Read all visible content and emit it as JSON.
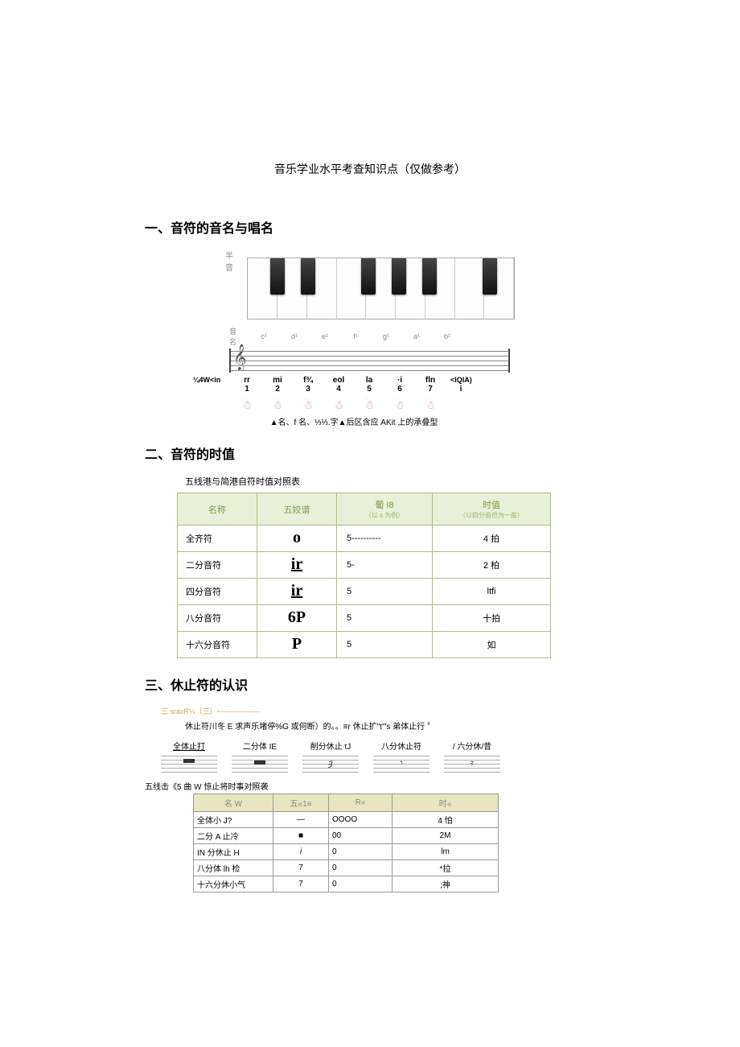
{
  "doc_title": "音乐学业水平考查知识点（仅做参考）",
  "section1": {
    "title": "一、音符的音名与唱名",
    "piano_label": "半音",
    "name_label": "音名",
    "note_names": [
      "c¹",
      "d¹",
      "e¹",
      "f¹",
      "g¹",
      "a¹",
      "b¹",
      ""
    ],
    "solfege_pre": "¼4W<in",
    "solfege": [
      "rr",
      "mi",
      "f¾",
      "eol",
      "la",
      "·i",
      "fln"
    ],
    "solfege_post": "<lQlA)",
    "numbers": [
      "1",
      "2",
      "3",
      "4",
      "5",
      "6",
      "7",
      "i"
    ],
    "caption": "▲名、f 名、⅓⅓.字▲后区含应 AKit 上的承叠型"
  },
  "section2": {
    "title": "二、音符的时值",
    "table_caption": "五线港与简港自符时值对照表",
    "headers": {
      "name": "名称",
      "staff": "五姣谱",
      "jianpu": "葡 I8",
      "jianpu_sub": "（以 s 为例）",
      "duration": "时值",
      "duration_sub": "（以四分音符为一般）"
    },
    "rows": [
      {
        "name": "全齐符",
        "staff": "o",
        "jianpu": "5----------",
        "duration": "4 拍"
      },
      {
        "name": "二分音符",
        "staff": "ir",
        "jianpu": "5-",
        "duration": "2 柏"
      },
      {
        "name": "四分音符",
        "staff": "ir",
        "jianpu": "5",
        "duration": "ltfi"
      },
      {
        "name": "八分音符",
        "staff": "6P",
        "jianpu": "5",
        "duration": "十拍"
      },
      {
        "name": "十六分音符",
        "staff": "P",
        "jianpu": "5",
        "duration": "如"
      }
    ]
  },
  "section3": {
    "title": "三、休止符的认识",
    "sub_caption": "三 sraxR¼（三）~----------------",
    "desc": "休止符川冬 E 求声乐堵停%G 或何断）的。。≡r 休止扩\"t'\"s 弟体止行 〞",
    "rests": [
      {
        "label": "全体止打"
      },
      {
        "label": "二分体 IE"
      },
      {
        "label": "削分休止 tJ"
      },
      {
        "label": "八分休止符"
      },
      {
        "label": "/ 六分休/昔"
      }
    ],
    "rest_table_caption": "五线击《5 曲 W 惊止将时事对照袭",
    "rest_headers": {
      "name": "名 W",
      "staff": "五«1≡",
      "jianpu": "R«",
      "duration": "时«"
    },
    "rest_rows": [
      {
        "name": "全体小 J?",
        "staff": "—",
        "jianpu": "OOOO",
        "duration": "4 怕"
      },
      {
        "name": "二分 A 止冷",
        "staff": "■",
        "jianpu": "00",
        "duration": "2M"
      },
      {
        "name": "IN 分休止 H",
        "staff": "i",
        "jianpu": "0",
        "duration": "lm"
      },
      {
        "name": "八分体 lh 检",
        "staff": "7",
        "jianpu": "0",
        "duration": "*拉"
      },
      {
        "name": "十六分休小气",
        "staff": "7",
        "jianpu": "0",
        "duration": ";神"
      }
    ]
  }
}
